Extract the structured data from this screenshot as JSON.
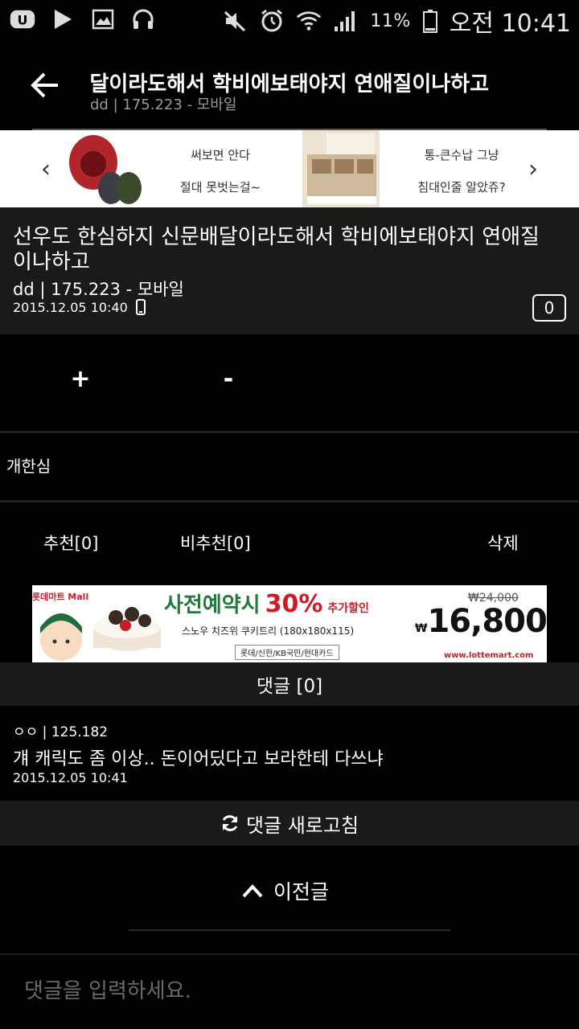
{
  "status_bar": {
    "battery": "11%",
    "time": "오전 10:41"
  },
  "header": {
    "title": "선우도 한심하지 신문배달이라도해서 학비에보태야지 연애질이나하고",
    "subtitle": "dd | 175.223 - 모바일"
  },
  "top_ad": {
    "item1_line1": "써보면 안다",
    "item1_line2": "절대 못벗는걸~",
    "item2_line1": "통-큰수납 그냥",
    "item2_line2": "침대인줄 알았쥬?"
  },
  "post": {
    "title": "선우도 한심하지 신문배달이라도해서 학비에보태야지 연애질이나하고",
    "author": "dd | 175.223 - 모바일",
    "date": "2015.12.05 10:40",
    "comment_count": "0",
    "body": "개한심"
  },
  "vote": {
    "plus": "+",
    "minus": "-"
  },
  "actions": {
    "recommend": "추천[0]",
    "not_recommend": "비추천[0]",
    "delete": "삭제"
  },
  "mid_ad": {
    "brand": "롯데마트 Mall",
    "headline": "사전예약시",
    "discount": "30%",
    "discount_suffix": "추가할인",
    "product": "스노우 치즈위 쿠키트리 (180x180x115)",
    "cards": "롯데/신한/KB국민/현대카드",
    "old_price": "₩24,000",
    "price_symbol": "₩",
    "price": "16,800",
    "url": "www.lottemart.com"
  },
  "comments": {
    "header": "댓글 [0]",
    "items": [
      {
        "author": "ㅇㅇ | 125.182",
        "text": "걔 캐릭도 좀 이상.. 돈이어딨다고 보라한테 다쓰냐",
        "date": "2015.12.05 10:41"
      }
    ],
    "refresh_label": "댓글 새로고침"
  },
  "prev_post": {
    "label": "이전글"
  },
  "comment_input": {
    "placeholder": "댓글을 입력하세요."
  },
  "icons": [
    "app-u-icon",
    "play-store-icon",
    "image-icon",
    "headset-icon",
    "mute-icon",
    "alarm-icon",
    "wifi-icon",
    "signal-icon",
    "battery-icon",
    "back-arrow-icon",
    "chevron-left-icon",
    "chevron-right-icon",
    "mobile-icon",
    "refresh-icon",
    "chevron-up-icon"
  ]
}
